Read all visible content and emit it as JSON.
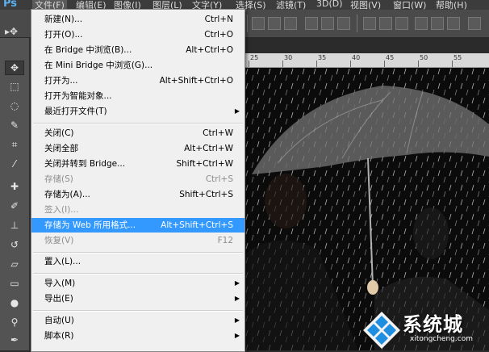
{
  "menubar": {
    "logo": "Ps",
    "items": [
      "文件(F)",
      "编辑(E)",
      "图像(I)",
      "图层(L)",
      "文字(Y)",
      "选择(S)",
      "滤镜(T)",
      "3D(D)",
      "视图(V)",
      "窗口(W)",
      "帮助(H)"
    ]
  },
  "file_menu": {
    "items": [
      {
        "label": "新建(N)...",
        "shortcut": "Ctrl+N"
      },
      {
        "label": "打开(O)...",
        "shortcut": "Ctrl+O"
      },
      {
        "label": "在 Bridge 中浏览(B)...",
        "shortcut": "Alt+Ctrl+O"
      },
      {
        "label": "在 Mini Bridge 中浏览(G)...",
        "shortcut": ""
      },
      {
        "label": "打开为...",
        "shortcut": "Alt+Shift+Ctrl+O"
      },
      {
        "label": "打开为智能对象...",
        "shortcut": ""
      },
      {
        "label": "最近打开文件(T)",
        "shortcut": ""
      },
      {
        "label": "关闭(C)",
        "shortcut": "Ctrl+W"
      },
      {
        "label": "关闭全部",
        "shortcut": "Alt+Ctrl+W"
      },
      {
        "label": "关闭并转到 Bridge...",
        "shortcut": "Shift+Ctrl+W"
      },
      {
        "label": "存储(S)",
        "shortcut": "Ctrl+S"
      },
      {
        "label": "存储为(A)...",
        "shortcut": "Shift+Ctrl+S"
      },
      {
        "label": "签入(I)...",
        "shortcut": ""
      },
      {
        "label": "存储为 Web 所用格式...",
        "shortcut": "Alt+Shift+Ctrl+S"
      },
      {
        "label": "恢复(V)",
        "shortcut": "F12"
      },
      {
        "label": "置入(L)...",
        "shortcut": ""
      },
      {
        "label": "导入(M)",
        "shortcut": ""
      },
      {
        "label": "导出(E)",
        "shortcut": ""
      },
      {
        "label": "自动(U)",
        "shortcut": ""
      },
      {
        "label": "脚本(R)",
        "shortcut": ""
      }
    ]
  },
  "ruler": {
    "labels": [
      "25",
      "30",
      "35",
      "40",
      "45",
      "50",
      "55"
    ]
  },
  "watermark": {
    "brand": "系统城",
    "url": "xitongcheng.com"
  }
}
